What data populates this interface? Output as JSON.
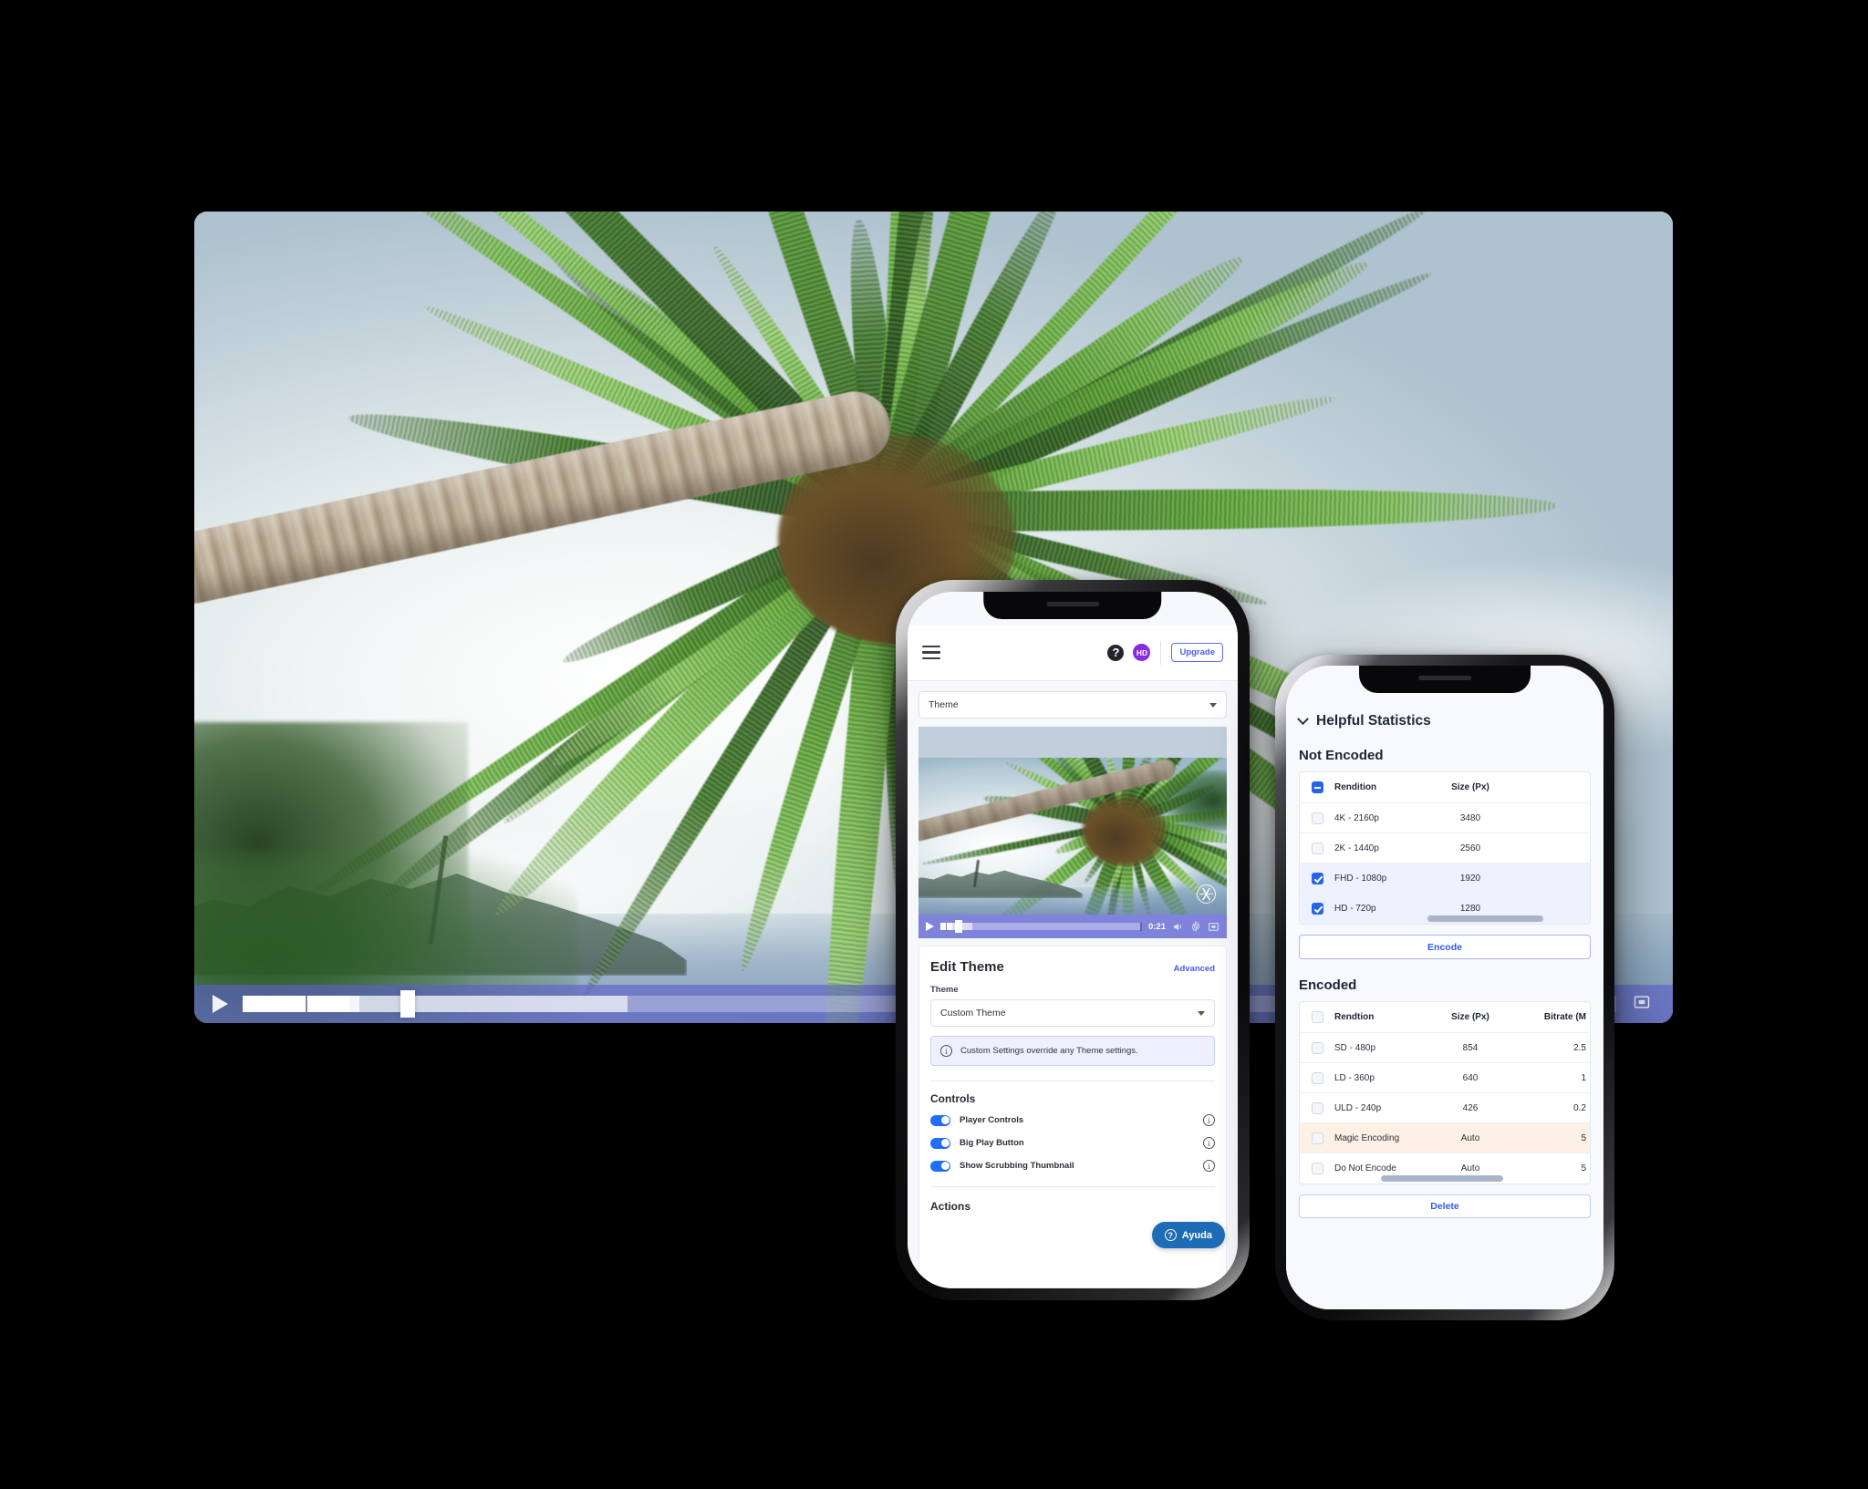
{
  "main_player": {
    "name": "video-player-desktop",
    "play_label": "Play",
    "fullscreen_label": "Fullscreen",
    "progress_percent": 12,
    "accent": "#5c60c8"
  },
  "phone1": {
    "topbar": {
      "menu_label": "Menu",
      "help_label": "?",
      "avatar_initials": "HD",
      "avatar_color": "#8a2be2",
      "upgrade_label": "Upgrade"
    },
    "theme_select": {
      "value": "Theme"
    },
    "video": {
      "time": "0:21",
      "play_label": "Play",
      "volume_label": "Volume",
      "settings_label": "Settings",
      "fullscreen_label": "Fullscreen"
    },
    "card": {
      "title": "Edit Theme",
      "advanced_label": "Advanced",
      "theme_label": "Theme",
      "theme_value": "Custom Theme",
      "note": "Custom Settings override any Theme settings.",
      "controls_title": "Controls",
      "toggles": [
        {
          "label": "Player Controls",
          "on": true
        },
        {
          "label": "Big Play Button",
          "on": true
        },
        {
          "label": "Show Scrubbing Thumbnail",
          "on": true
        }
      ],
      "actions_title": "Actions"
    },
    "help_button": {
      "label": "Ayuda"
    }
  },
  "phone2": {
    "header": "Helpful Statistics",
    "not_encoded": {
      "title": "Not Encoded",
      "columns": [
        "Rendition",
        "Size (Px)"
      ],
      "rows": [
        {
          "rendition": "4K - 2160p",
          "size": "3480",
          "checked": false,
          "highlight": "none"
        },
        {
          "rendition": "2K - 1440p",
          "size": "2560",
          "checked": false,
          "highlight": "none"
        },
        {
          "rendition": "FHD - 1080p",
          "size": "1920",
          "checked": true,
          "highlight": "sel"
        },
        {
          "rendition": "HD - 720p",
          "size": "1280",
          "checked": true,
          "highlight": "sel"
        }
      ],
      "encode_label": "Encode"
    },
    "encoded": {
      "title": "Encoded",
      "columns": [
        "Rendtion",
        "Size (Px)",
        "Bitrate (M"
      ],
      "rows": [
        {
          "rendition": "SD - 480p",
          "size": "854",
          "bitrate": "2.5",
          "checked": false,
          "highlight": "none"
        },
        {
          "rendition": "LD - 360p",
          "size": "640",
          "bitrate": "1",
          "checked": false,
          "highlight": "none"
        },
        {
          "rendition": "ULD - 240p",
          "size": "426",
          "bitrate": "0.2",
          "checked": false,
          "highlight": "none"
        },
        {
          "rendition": "Magic Encoding",
          "size": "Auto",
          "bitrate": "5",
          "checked": false,
          "highlight": "warn"
        },
        {
          "rendition": "Do Not Encode",
          "size": "Auto",
          "bitrate": "5",
          "checked": false,
          "highlight": "none"
        }
      ]
    },
    "bottom_button_label": "Delete"
  }
}
